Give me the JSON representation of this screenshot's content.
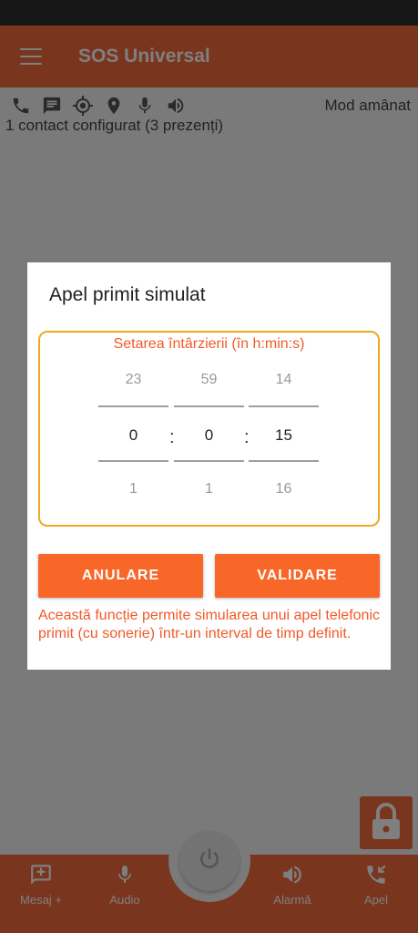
{
  "app": {
    "title": "SOS Universal"
  },
  "status": {
    "mode": "Mod amânat",
    "contacts": "1 contact configurat (3 prezenți)",
    "icons": [
      "phone-icon",
      "message-icon",
      "gps-icon",
      "location-pin-icon",
      "microphone-icon",
      "speaker-icon"
    ]
  },
  "nav": {
    "message": "Mesaj +",
    "audio": "Audio",
    "alarm": "Alarmă",
    "call": "Apel"
  },
  "dialog": {
    "title": "Apel primit simulat",
    "picker_label": "Setarea întârzierii (în h:min:s)",
    "hours": {
      "prev": "23",
      "value": "0",
      "next": "1"
    },
    "minutes": {
      "prev": "59",
      "value": "0",
      "next": "1"
    },
    "seconds": {
      "prev": "14",
      "value": "15",
      "next": "16"
    },
    "separator": ":",
    "cancel": "ANULARE",
    "confirm": "VALIDARE",
    "description": "Această funcție permite simularea unui apel telefonic primit (cu sonerie) într-un interval de timp definit."
  },
  "colors": {
    "accent": "#f26a3a",
    "button": "#f86628",
    "picker_border": "#f0a820"
  }
}
